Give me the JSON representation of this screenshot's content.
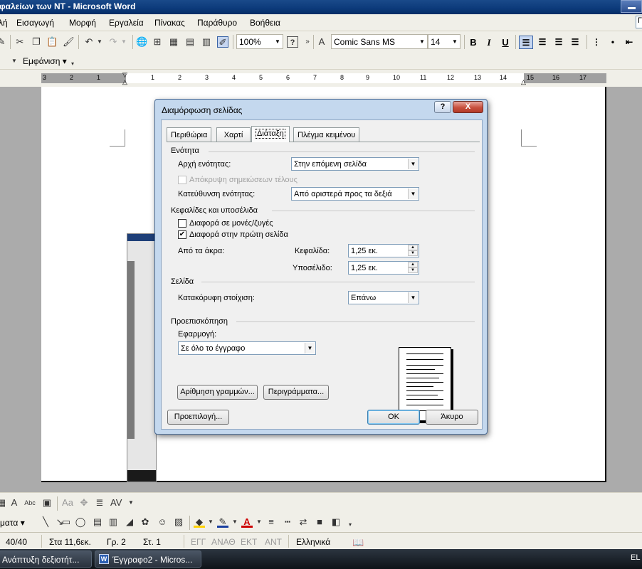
{
  "window": {
    "title": "φαλείων των NT - Microsoft Word"
  },
  "menubar": {
    "items": [
      "λή",
      "Εισαγωγή",
      "Μορφή",
      "Εργαλεία",
      "Πίνακας",
      "Παράθυρο",
      "Βοήθεια"
    ],
    "right_field": "Γ"
  },
  "toolbar": {
    "zoom": "100%",
    "font": "Comic Sans MS",
    "size": "14",
    "bold": "B",
    "italic": "I",
    "underline": "U"
  },
  "toolbar2": {
    "view": "Εμφάνιση ▾"
  },
  "ruler": {
    "numbers": [
      "3",
      "2",
      "1",
      "1",
      "2",
      "3",
      "4",
      "5",
      "6",
      "7",
      "8",
      "9",
      "10",
      "11",
      "12",
      "13",
      "14",
      "15",
      "16",
      "17"
    ]
  },
  "dialog": {
    "title": "Διαμόρφωση σελίδας",
    "help": "?",
    "close": "X",
    "tabs": [
      "Περιθώρια",
      "Χαρτί",
      "Διάταξη",
      "Πλέγμα κειμένου"
    ],
    "section": {
      "heading": "Ενότητα",
      "start_label": "Αρχή ενότητας:",
      "start_value": "Στην επόμενη σελίδα",
      "suppress_endnotes": "Απόκρυψη σημειώσεων τέλους",
      "direction_label": "Κατεύθυνση ενότητας:",
      "direction_value": "Από αριστερά προς τα δεξιά"
    },
    "headers": {
      "heading": "Κεφαλίδες και υποσέλιδα",
      "odd_even": "Διαφορά σε μονές/ζυγές",
      "odd_even_checked": false,
      "first_page": "Διαφορά στην πρώτη σελίδα",
      "first_page_checked": true,
      "from_edge": "Από τα άκρα:",
      "header_label": "Κεφαλίδα:",
      "header_value": "1,25 εκ.",
      "footer_label": "Υποσέλιδο:",
      "footer_value": "1,25 εκ."
    },
    "page": {
      "heading": "Σελίδα",
      "valign_label": "Κατακόρυφη στοίχιση:",
      "valign_value": "Επάνω"
    },
    "preview": {
      "heading": "Προεπισκόπηση",
      "apply_label": "Εφαρμογή:",
      "apply_value": "Σε όλο το έγγραφο"
    },
    "buttons": {
      "line_numbers": "Αρίθμηση γραμμών...",
      "borders": "Περιγράμματα...",
      "default": "Προεπιλογή...",
      "ok": "OK",
      "cancel": "Άκυρο"
    }
  },
  "drawing": {
    "shapes": "ματα ▾"
  },
  "status": {
    "page": "40/40",
    "at": "Στα 11,6εκ.",
    "line": "Γρ. 2",
    "col": "Στ. 1",
    "rec": "ΕΓΓ",
    "trk": "ΑΝΑΘ",
    "ext": "ΕΚΤ",
    "ovr": "ΑΝΤ",
    "lang": "Ελληνικά"
  },
  "taskbar": {
    "task1": "Ανάπτυξη δεξιοτήτ...",
    "task2": "Έγγραφο2 - Micros...",
    "lang": "EL"
  }
}
